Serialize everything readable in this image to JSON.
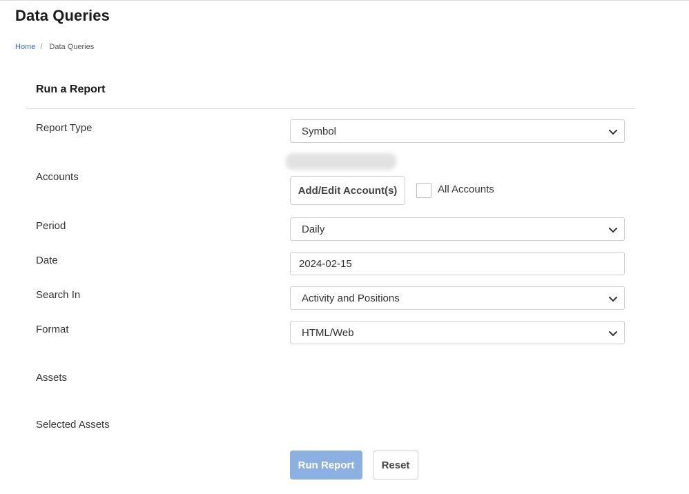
{
  "page": {
    "title": "Data Queries"
  },
  "breadcrumb": {
    "home": "Home",
    "separator": "/",
    "current": "Data Queries"
  },
  "form": {
    "title": "Run a Report",
    "report_type": {
      "label": "Report Type",
      "value": "Symbol"
    },
    "accounts": {
      "label": "Accounts",
      "add_edit_button": "Add/Edit Account(s)",
      "all_accounts_label": "All Accounts",
      "all_accounts_checked": false
    },
    "period": {
      "label": "Period",
      "value": "Daily"
    },
    "date": {
      "label": "Date",
      "value": "2024-02-15"
    },
    "search_in": {
      "label": "Search In",
      "value": "Activity and Positions"
    },
    "format": {
      "label": "Format",
      "value": "HTML/Web"
    },
    "assets": {
      "label": "Assets"
    },
    "selected_assets": {
      "label": "Selected Assets"
    },
    "run_button": "Run Report",
    "reset_button": "Reset"
  },
  "colors": {
    "link": "#2f6bb5",
    "primary_button_disabled": "#8cb0e2",
    "border": "#cfcfcf"
  },
  "icons": {
    "select_arrow": "chevron-down-icon"
  }
}
